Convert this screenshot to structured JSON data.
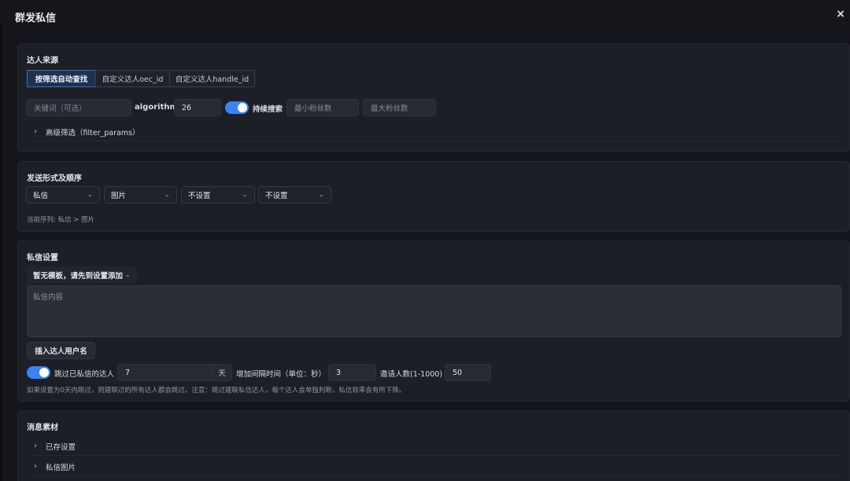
{
  "dialog": {
    "title": "群发私信",
    "close": "×"
  },
  "source": {
    "title": "达人来源",
    "tabs": [
      "按筛选自动查找",
      "自定义达人oec_id",
      "自定义达人handle_id"
    ],
    "keyword_placeholder": "关键词（可选）",
    "algorithm_label": "algorithm",
    "algorithm_value": "26",
    "continuous_search_label": "持续搜索",
    "continuous_search_on": true,
    "min_fans_placeholder": "最小粉丝数",
    "max_fans_placeholder": "最大粉丝数",
    "advanced_label": "高级筛选（filter_params）"
  },
  "send_form": {
    "title": "发送形式及顺序",
    "selects": [
      "私信",
      "图片",
      "不设置",
      "不设置"
    ],
    "current_sequence": "当前序列: 私信 > 图片"
  },
  "dm": {
    "title": "私信设置",
    "template_select": "暂无模板，请先到设置添加",
    "content_placeholder": "私信内容",
    "insert_button": "插入达人用户名",
    "skip_label": "跳过已私信的达人",
    "skip_on": true,
    "skip_days": "7",
    "days_unit": "天",
    "interval_label": "增加间隔时间（单位：秒）",
    "interval_value": "3",
    "invite_label": "邀请人数(1-1000)",
    "invite_value": "50",
    "note": "如果设置为0天内跳过，则建联过的所有达人都会跳过。注意：跳过建联私信达人，每个达人会单独判断，私信效率会有所下降。"
  },
  "material": {
    "title": "消息素材",
    "items": [
      "已存设置",
      "私信图片"
    ]
  },
  "colors": {
    "accent": "#3b82f6",
    "background": "#14161b",
    "card": "#1c1f25"
  }
}
